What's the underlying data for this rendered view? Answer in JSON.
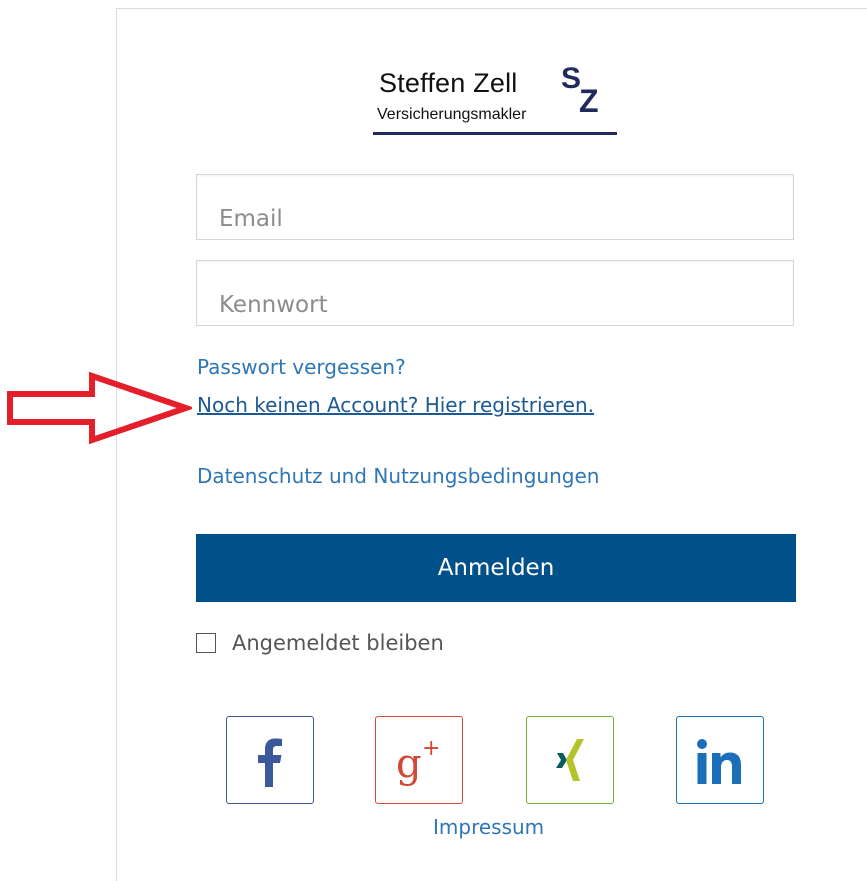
{
  "logo": {
    "name": "Steffen Zell",
    "subtitle": "Versicherungsmakler",
    "mark_letter_1": "S",
    "mark_letter_2": "Z"
  },
  "form": {
    "email_placeholder": "Email",
    "password_placeholder": "Kennwort",
    "forgot_password": "Passwort vergessen?",
    "register_link": "Noch keinen Account? Hier registrieren.",
    "privacy_link": "Datenschutz",
    "privacy_and": " und ",
    "terms_link": "Nutzungsbedingungen",
    "login_button": "Anmelden",
    "remember_me": "Angemeldet bleiben"
  },
  "social": [
    {
      "name": "facebook-icon",
      "color": "#3b5998"
    },
    {
      "name": "google-plus-icon",
      "color": "#d14836"
    },
    {
      "name": "xing-icon",
      "color": "#6cb33f"
    },
    {
      "name": "linkedin-icon",
      "color": "#1a6fb8"
    }
  ],
  "footer": {
    "impressum": "Impressum"
  },
  "colors": {
    "primary": "#02508a",
    "link": "#2f76b6",
    "annotation_arrow": "#e3202a"
  }
}
